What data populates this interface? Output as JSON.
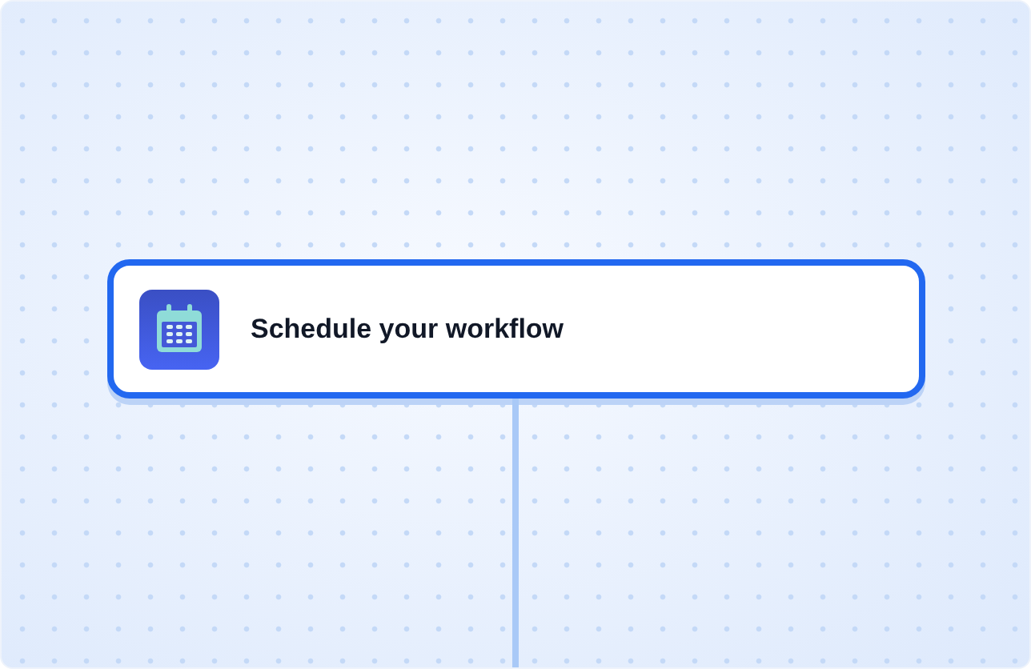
{
  "node": {
    "title": "Schedule your workflow",
    "selected": true
  }
}
